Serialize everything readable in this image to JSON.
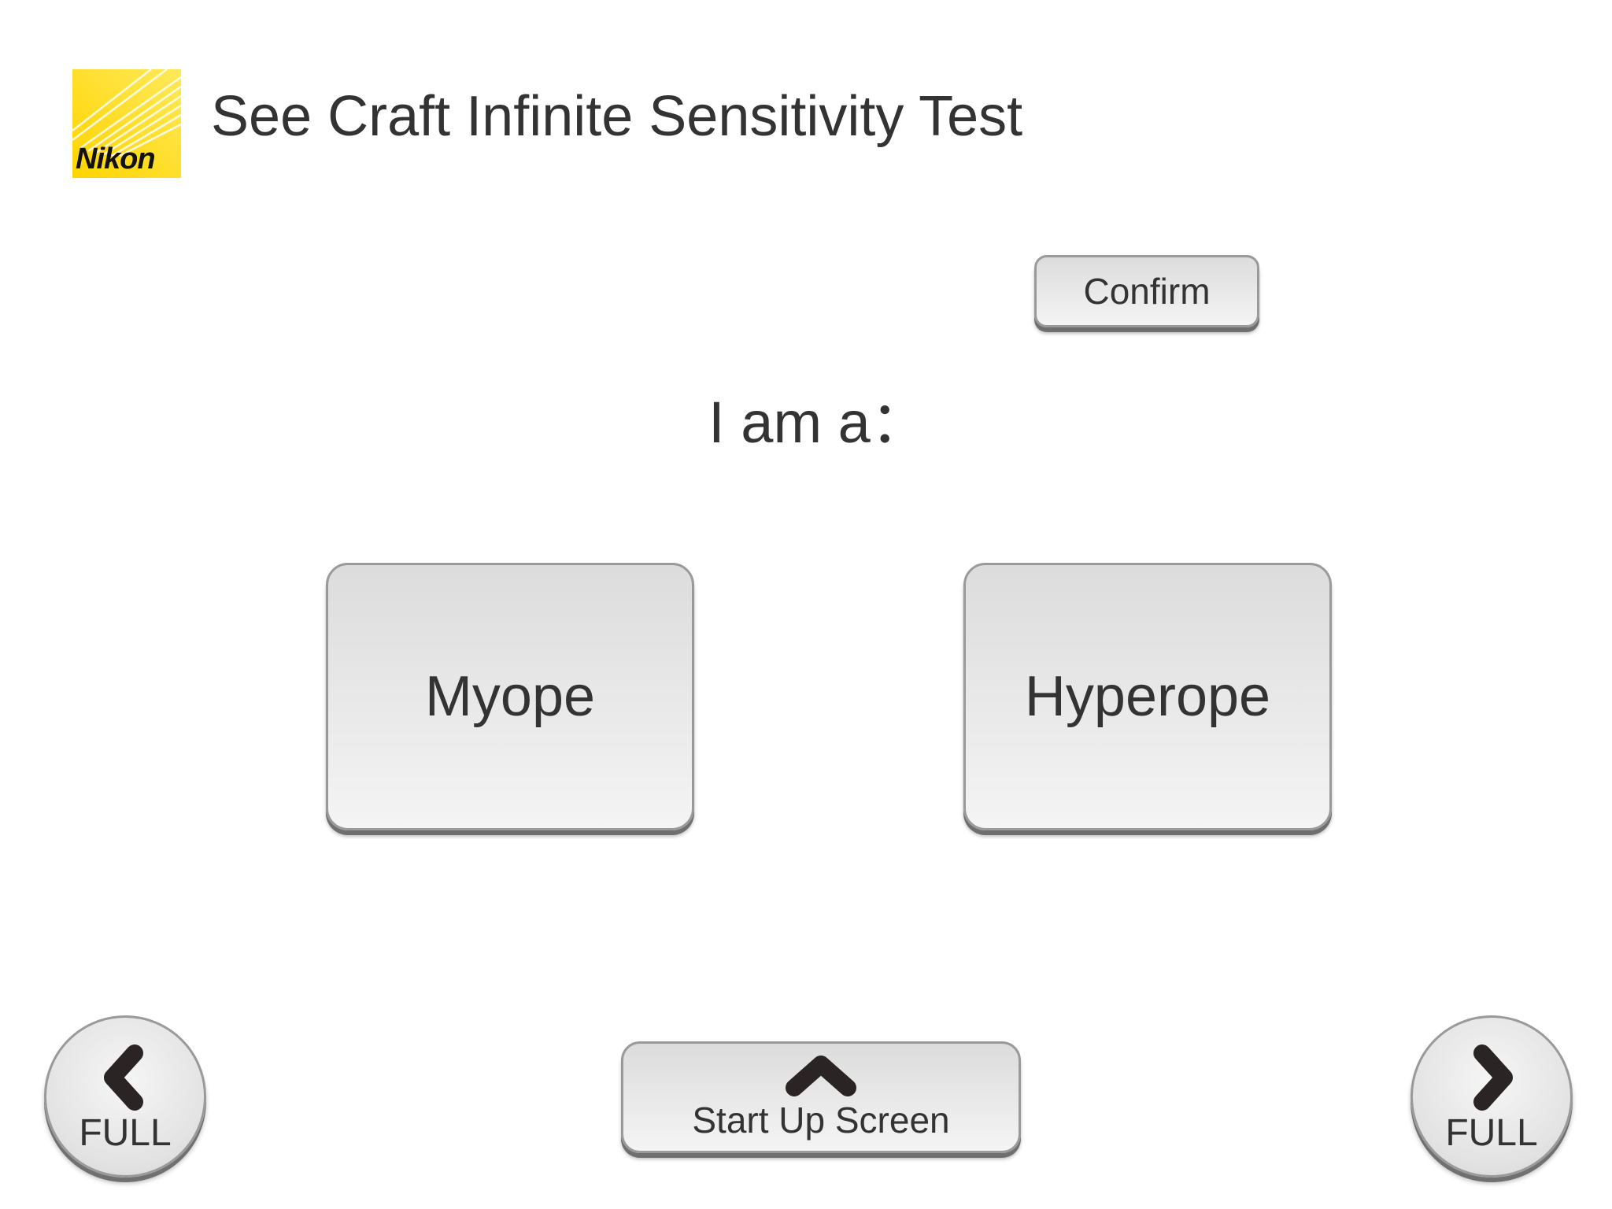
{
  "brand": {
    "logo_text": "Nikon",
    "logo_color": "#FFE100"
  },
  "header": {
    "title": "See Craft Infinite Sensitivity Test"
  },
  "actions": {
    "confirm_label": "Confirm"
  },
  "prompt": {
    "text": "I am a："
  },
  "choices": [
    {
      "label": "Myope"
    },
    {
      "label": "Hyperope"
    }
  ],
  "navigation": {
    "back": {
      "label": "FULL",
      "icon": "chevron-left-icon"
    },
    "home": {
      "label": "Start Up Screen",
      "icon": "chevron-up-icon"
    },
    "next": {
      "label": "FULL",
      "icon": "chevron-right-icon"
    }
  }
}
